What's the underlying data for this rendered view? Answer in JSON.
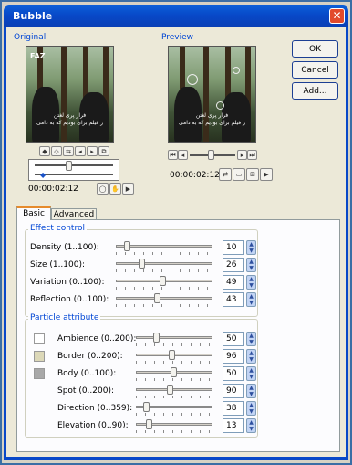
{
  "dialog": {
    "title": "Bubble",
    "close_glyph": "✕"
  },
  "original": {
    "label": "Original",
    "timecode": "00:00:02:12",
    "video_caption_line1": "فرار پری لغتن",
    "video_caption_line2": "ر فیلم برای بودیم که به دامی",
    "video_logo": "FAZ"
  },
  "preview": {
    "label": "Preview",
    "timecode": "00:00:02:12",
    "video_caption_line1": "فرار پری لغتن",
    "video_caption_line2": "ر فیلم برای بودیم که به دامی"
  },
  "buttons": {
    "ok": "OK",
    "cancel": "Cancel",
    "add": "Add..."
  },
  "tabs": [
    {
      "label": "Basic",
      "active": true
    },
    {
      "label": "Advanced",
      "active": false
    }
  ],
  "effect_control": {
    "label": "Effect control",
    "rows": [
      {
        "label": "Density (1..100):",
        "value": "10",
        "level": 0.09
      },
      {
        "label": "Size (1..100):",
        "value": "26",
        "level": 0.25
      },
      {
        "label": "Variation (0..100):",
        "value": "49",
        "level": 0.49
      },
      {
        "label": "Reflection (0..100):",
        "value": "43",
        "level": 0.43
      }
    ]
  },
  "particle_attribute": {
    "label": "Particle attribute",
    "rows": [
      {
        "label": "Ambience (0..200):",
        "value": "50",
        "level": 0.25,
        "swatch": "#ffffff"
      },
      {
        "label": "Border (0..200):",
        "value": "96",
        "level": 0.48,
        "swatch": "#dcd8b8"
      },
      {
        "label": "Body (0..100):",
        "value": "50",
        "level": 0.5,
        "swatch": "#a8a8a8"
      },
      {
        "label": "Spot (0..200):",
        "value": "90",
        "level": 0.45,
        "swatch": ""
      },
      {
        "label": "Direction (0..359):",
        "value": "38",
        "level": 0.1,
        "swatch": ""
      },
      {
        "label": "Elevation (0..90):",
        "value": "13",
        "level": 0.14,
        "swatch": ""
      }
    ]
  }
}
